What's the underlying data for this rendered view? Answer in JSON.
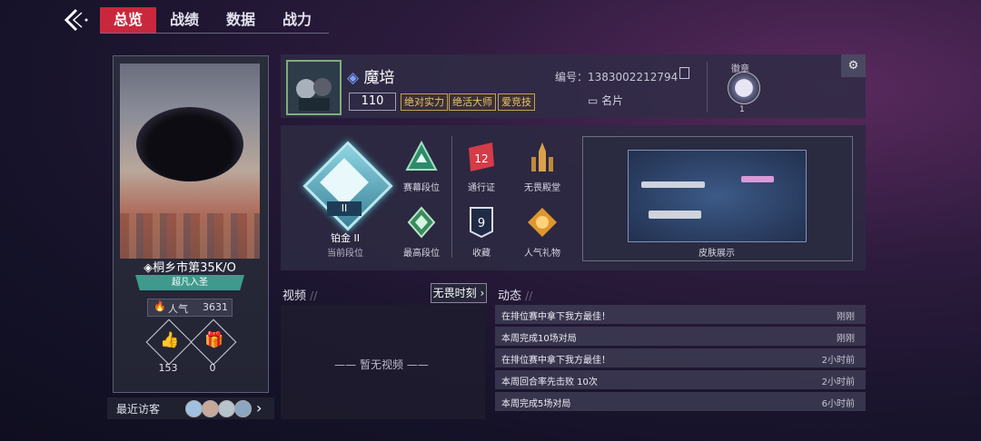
{
  "nav": {
    "tabs": [
      "总览",
      "战绩",
      "数据",
      "战力"
    ],
    "active_tab": "总览"
  },
  "player_card": {
    "location": "桐乡市第35K/O",
    "title_banner": "超凡入圣",
    "popularity_label": "人气",
    "popularity_value": "3631",
    "likes": "153",
    "gifts": "0",
    "recent_visitors_label": "最近访客"
  },
  "profile": {
    "name": "魔培",
    "level": "110",
    "tags": [
      "绝对实力",
      "绝活大师",
      "爱竞技"
    ],
    "id_text": "编号：1383002212794",
    "namecard_label": "名片",
    "badge_label": "徽章",
    "badge_count": "1"
  },
  "rank": {
    "current_rank": "铂金 II",
    "current_rank_label": "当前段位",
    "roman": "II",
    "items": [
      {
        "label": "赛幕段位",
        "icon": "triangle-rank-icon"
      },
      {
        "label": "通行证",
        "icon": "pass-icon",
        "value": "12"
      },
      {
        "label": "无畏殿堂",
        "icon": "hall-icon"
      },
      {
        "label": "最高段位",
        "icon": "highest-rank-icon"
      },
      {
        "label": "收藏",
        "icon": "collection-icon",
        "value": "9"
      },
      {
        "label": "人气礼物",
        "icon": "gift-popularity-icon"
      }
    ],
    "skin_label": "皮肤展示"
  },
  "video": {
    "title": "视频",
    "button": "无畏时刻",
    "empty": "暂无视频"
  },
  "feed": {
    "title": "动态",
    "items": [
      {
        "text": "在排位赛中拿下我方最佳！",
        "time": "刚刚"
      },
      {
        "text": "本周完成10场对局",
        "time": "刚刚"
      },
      {
        "text": "在排位赛中拿下我方最佳！",
        "time": "2小时前"
      },
      {
        "text": "本周回合率先击败 10次",
        "time": "2小时前"
      },
      {
        "text": "本周完成5场对局",
        "time": "6小时前"
      }
    ]
  }
}
